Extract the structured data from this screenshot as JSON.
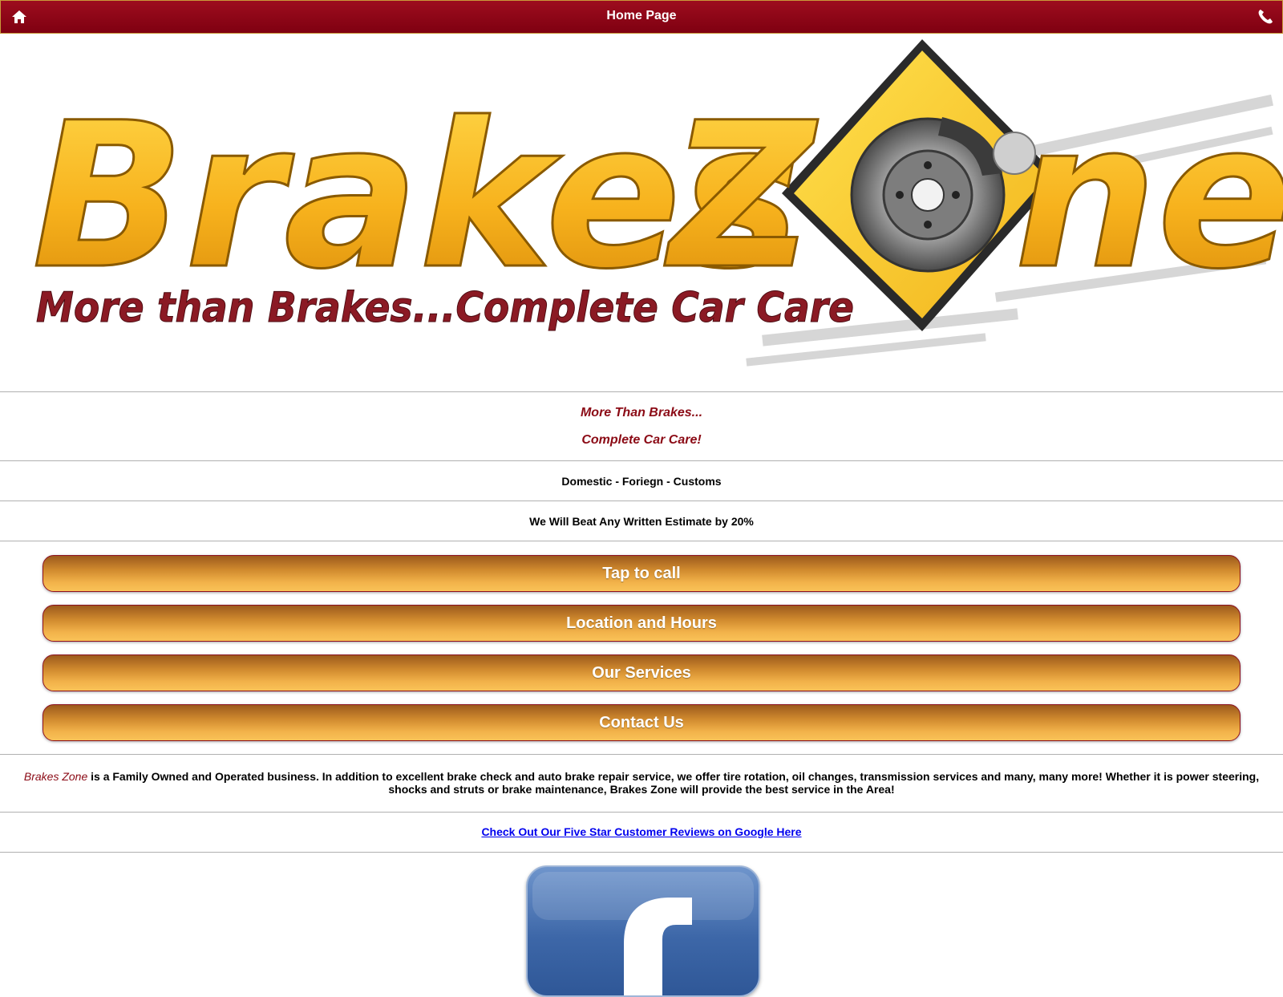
{
  "header": {
    "title": "Home Page",
    "home_icon": "home-icon",
    "phone_icon": "phone-icon",
    "bar_color": "#8b0a15"
  },
  "logo": {
    "brand_word_1": "Brakes",
    "brand_word_2": "Z",
    "brand_word_3": "ne",
    "tagline": "More than Brakes...Complete Car Care"
  },
  "slogan": {
    "line1": "More Than Brakes...",
    "line2": "Complete Car Care!"
  },
  "info": {
    "vehicle_types": "Domestic - Foriegn - Customs",
    "estimate_offer": "We Will Beat Any Written Estimate by 20%"
  },
  "menu": {
    "items": [
      {
        "label": "Tap to call"
      },
      {
        "label": "Location and Hours"
      },
      {
        "label": "Our Services"
      },
      {
        "label": "Contact Us"
      }
    ]
  },
  "about": {
    "brand": "Brakes Zone",
    "text": " is a Family Owned and Operated business. In addition to excellent brake check and auto brake repair service, we offer tire rotation, oil changes, transmission services and many, many more!  Whether it is power steering, shocks and struts or brake maintenance, Brakes Zone will provide the best service in the Area!"
  },
  "reviews": {
    "link_text": "Check Out Our Five Star Customer Reviews on Google Here"
  },
  "social": {
    "facebook_icon": "facebook-icon"
  },
  "colors": {
    "accent_red": "#8b0a15",
    "button_gold": "#f2b24a",
    "link_blue": "#0000ee"
  }
}
